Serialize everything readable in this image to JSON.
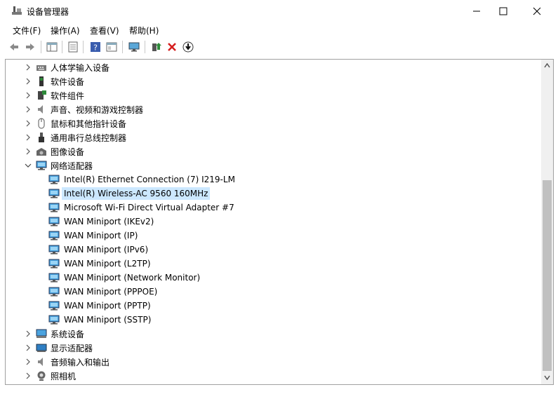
{
  "window": {
    "title": "设备管理器"
  },
  "menu": [
    "文件(F)",
    "操作(A)",
    "查看(V)",
    "帮助(H)"
  ],
  "colors": {
    "selection": "#cce8ff",
    "accent_blue": "#2b6cb0",
    "delete_red": "#d61f1f",
    "green": "#2e8b3a"
  },
  "toolbar": {
    "icons": [
      "back-arrow-icon",
      "forward-arrow-icon",
      "show-hide-console-icon",
      "properties-icon",
      "help-icon",
      "view-icon",
      "monitor-icon",
      "update-driver-icon",
      "uninstall-x-icon",
      "download-icon"
    ]
  },
  "tree": {
    "categories_top": [
      {
        "label": "人体学输入设备",
        "icon": "hid-icon"
      },
      {
        "label": "软件设备",
        "icon": "software-device-icon"
      },
      {
        "label": "软件组件",
        "icon": "software-component-icon"
      },
      {
        "label": "声音、视频和游戏控制器",
        "icon": "speaker-icon"
      },
      {
        "label": "鼠标和其他指针设备",
        "icon": "mouse-icon"
      },
      {
        "label": "通用串行总线控制器",
        "icon": "usb-icon"
      },
      {
        "label": "图像设备",
        "icon": "camera-icon"
      }
    ],
    "expanded": {
      "label": "网络适配器",
      "icon": "network-adapter-icon"
    },
    "adapters": [
      "Intel(R) Ethernet Connection (7) I219-LM",
      "Intel(R) Wireless-AC 9560 160MHz",
      "Microsoft Wi-Fi Direct Virtual Adapter #7",
      "WAN Miniport (IKEv2)",
      "WAN Miniport (IP)",
      "WAN Miniport (IPv6)",
      "WAN Miniport (L2TP)",
      "WAN Miniport (Network Monitor)",
      "WAN Miniport (PPPOE)",
      "WAN Miniport (PPTP)",
      "WAN Miniport (SSTP)"
    ],
    "selected_index": 1,
    "categories_bottom": [
      {
        "label": "系统设备",
        "icon": "system-device-icon"
      },
      {
        "label": "显示适配器",
        "icon": "display-adapter-icon"
      },
      {
        "label": "音频输入和输出",
        "icon": "audio-io-icon"
      },
      {
        "label": "照相机",
        "icon": "webcam-icon"
      }
    ]
  }
}
